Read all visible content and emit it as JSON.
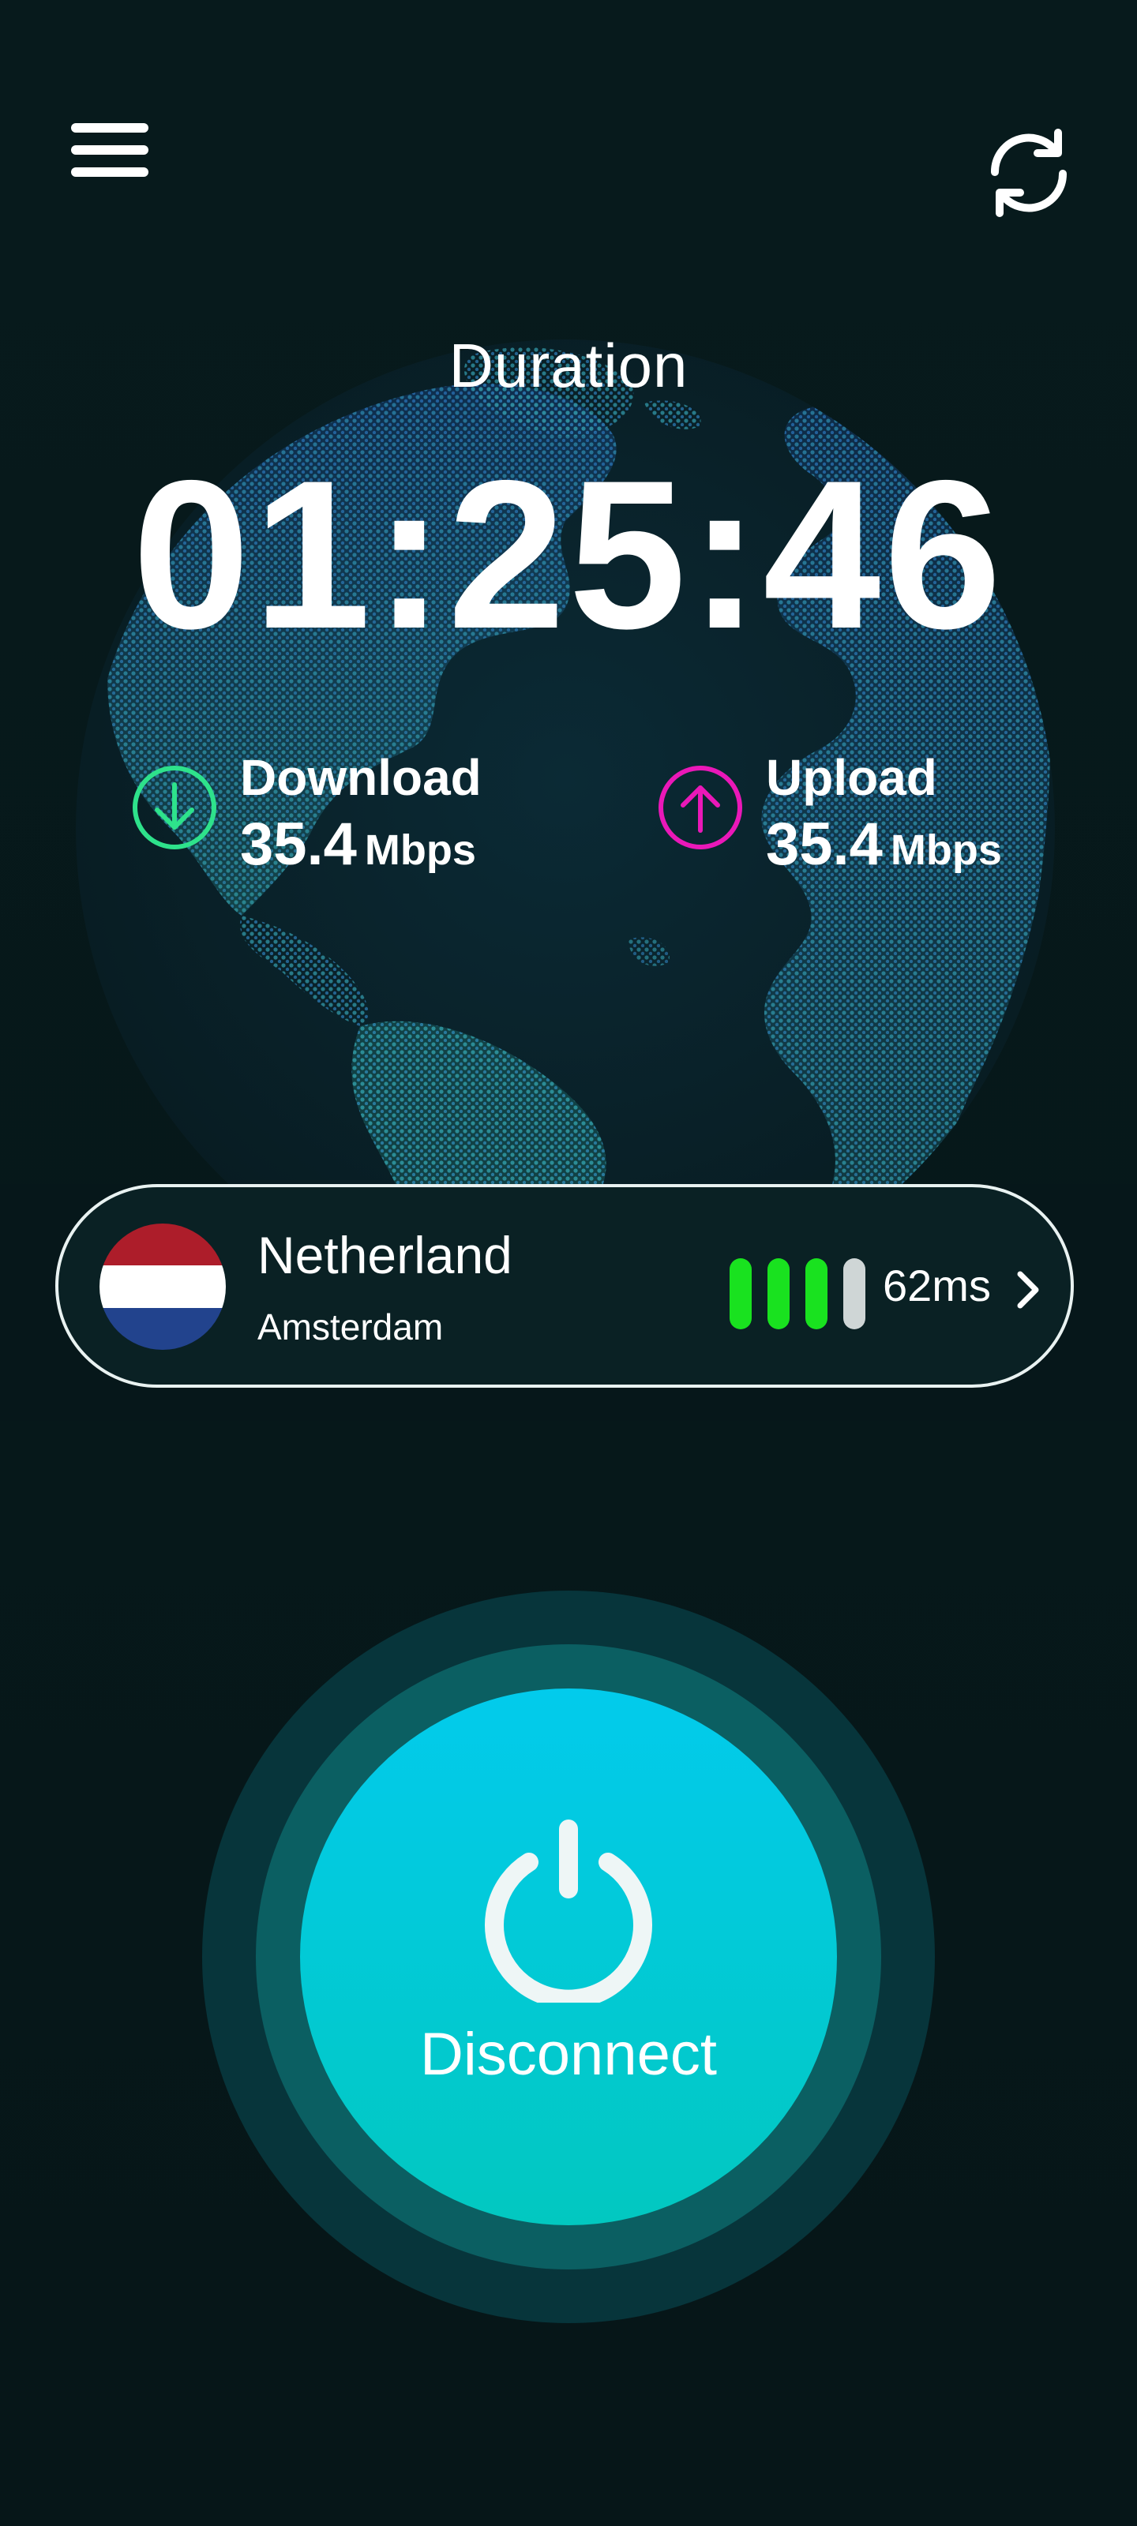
{
  "header": {
    "menu_icon": "hamburger-menu-icon",
    "refresh_icon": "refresh-icon"
  },
  "duration": {
    "label": "Duration",
    "time": "01:25:46"
  },
  "stats": {
    "download": {
      "title": "Download",
      "value": "35.4",
      "unit": "Mbps",
      "icon": "arrow-down-circle-icon",
      "color": "#2ee28b"
    },
    "upload": {
      "title": "Upload",
      "value": "35.4",
      "unit": "Mbps",
      "icon": "arrow-up-circle-icon",
      "color": "#ea18b8"
    }
  },
  "server": {
    "country": "Netherland",
    "city": "Amsterdam",
    "flag_icon": "netherlands-flag-icon",
    "ping": "62ms",
    "signal_active_bars": 3,
    "signal_total_bars": 4,
    "signal_active_color": "#19e21f",
    "signal_inactive_color": "#cfd6d6"
  },
  "power": {
    "label": "Disconnect",
    "icon": "power-icon"
  },
  "colors": {
    "background": "#06171a",
    "accent": "#02cbec",
    "accent_bottom": "#02c8c0"
  }
}
